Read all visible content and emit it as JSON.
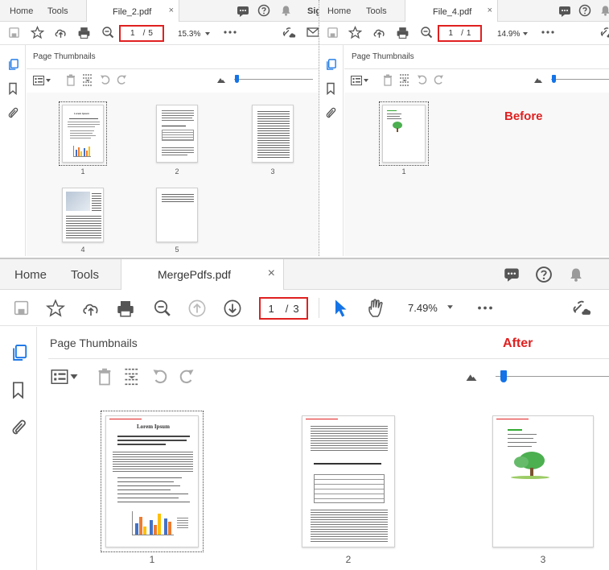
{
  "common": {
    "home_tab": "Home",
    "tools_tab": "Tools",
    "panel_title": "Page Thumbnails",
    "close_glyph": "×",
    "page_sep": "/"
  },
  "top_left": {
    "doc_tab": "File_2.pdf",
    "truncated_label": "Sig",
    "page_current": "1",
    "page_total": "5",
    "zoom": "15.3%",
    "thumbnails": [
      "1",
      "2",
      "3",
      "4",
      "5"
    ],
    "thumb_titles": {
      "page1": "Lorem Ipsum"
    }
  },
  "top_right": {
    "doc_tab": "File_4.pdf",
    "page_current": "1",
    "page_total": "1",
    "zoom": "14.9%",
    "thumbnails": [
      "1"
    ],
    "annotation": "Before"
  },
  "bottom": {
    "doc_tab": "MergePdfs.pdf",
    "page_current": "1",
    "page_total": "3",
    "zoom": "7.49%",
    "thumbnails": [
      "1",
      "2",
      "3"
    ],
    "annotation": "After",
    "thumb_titles": {
      "page1": "Lorem Ipsum"
    }
  },
  "colors": {
    "accent": "#1473e6",
    "annotation_red": "#e02020",
    "tree_green": "#4caf50"
  },
  "icons": [
    "save-icon",
    "star-icon",
    "upload-icon",
    "print-icon",
    "zoom-out-icon",
    "more-icon",
    "link-cloud-icon",
    "mail-icon",
    "comment-icon",
    "help-icon",
    "bell-icon",
    "page-thumbnails-icon",
    "bookmark-icon",
    "attachment-icon",
    "options-icon",
    "delete-icon",
    "insert-page-icon",
    "undo-icon",
    "redo-icon",
    "mountain-small-icon",
    "arrow-up-icon",
    "arrow-down-icon",
    "cursor-icon",
    "hand-icon"
  ]
}
